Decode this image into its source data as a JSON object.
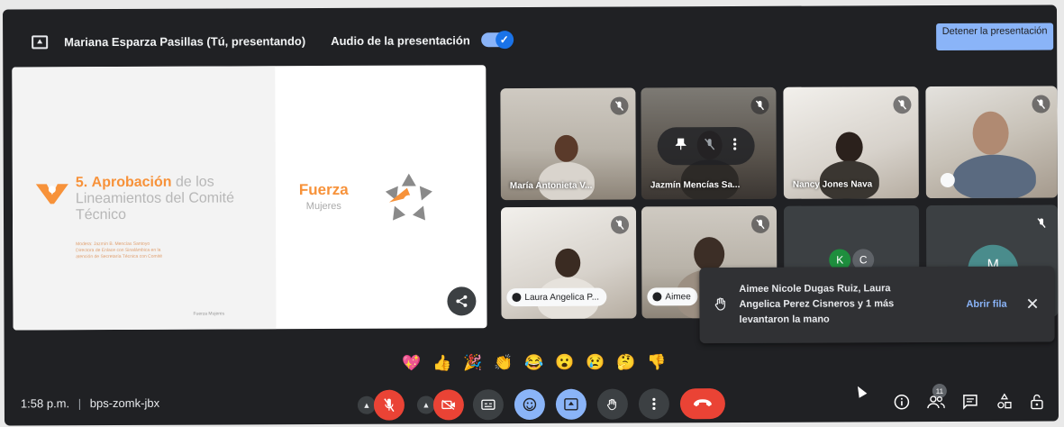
{
  "topbar": {
    "presenter": "Mariana Esparza Pasillas (Tú, presentando)",
    "audio_label": "Audio de la presentación",
    "audio_enabled": true,
    "stop_button": "Detener la presentación"
  },
  "slide": {
    "title_number": "5.",
    "title_strong": "Aprobación",
    "title_rest": "de los Lineamientos del Comité Técnico",
    "subtitle_lines": [
      "Modera: Jazmín B. Mencías Santoyo",
      "Directora de Enlace con Sinalámbica en la",
      "atención de Secretaría Técnica con Comité"
    ],
    "footer": "Fuerza Mujeres",
    "brand_top": "Fuerza",
    "brand_bottom": "Mujeres"
  },
  "tiles": [
    {
      "name": "María Antonieta V...",
      "muted": true
    },
    {
      "name": "Jazmín Mencías Sa...",
      "muted": true
    },
    {
      "name": "Nancy Jones Nava",
      "muted": true
    },
    {
      "name": "",
      "muted": true
    },
    {
      "name": "Laura Angelica P...",
      "muted": true,
      "hand_raised": true
    },
    {
      "name": "Aimee",
      "muted": true,
      "hand_raised": true
    },
    {
      "name": "",
      "avatars": [
        "K",
        "C"
      ]
    },
    {
      "name": "",
      "avatar": "M",
      "muted": true
    }
  ],
  "notification": {
    "text": "Aimee Nicole Dugas Ruiz, Laura Angelica Perez Cisneros y 1 más levantaron la mano",
    "action": "Abrir fila",
    "close": "✕"
  },
  "reactions": [
    "💖",
    "👍",
    "🎉",
    "👏",
    "😂",
    "😮",
    "😢",
    "🤔",
    "👎"
  ],
  "bottombar": {
    "time": "1:58 p.m.",
    "separator": "|",
    "meeting_code": "bps-zomk-jbx",
    "participants_count": "11"
  },
  "colors": {
    "background": "#202124",
    "accent": "#8ab4f8",
    "danger": "#ea4335",
    "brand_orange": "#f7923a"
  },
  "icons": [
    "present-icon",
    "mic-off-icon",
    "camera-off-icon",
    "captions-icon",
    "emoji-icon",
    "present-screen-icon",
    "raise-hand-icon",
    "more-options-icon",
    "end-call-icon",
    "info-icon",
    "people-icon",
    "chat-icon",
    "activities-icon",
    "host-controls-icon",
    "share-icon",
    "pin-icon"
  ]
}
